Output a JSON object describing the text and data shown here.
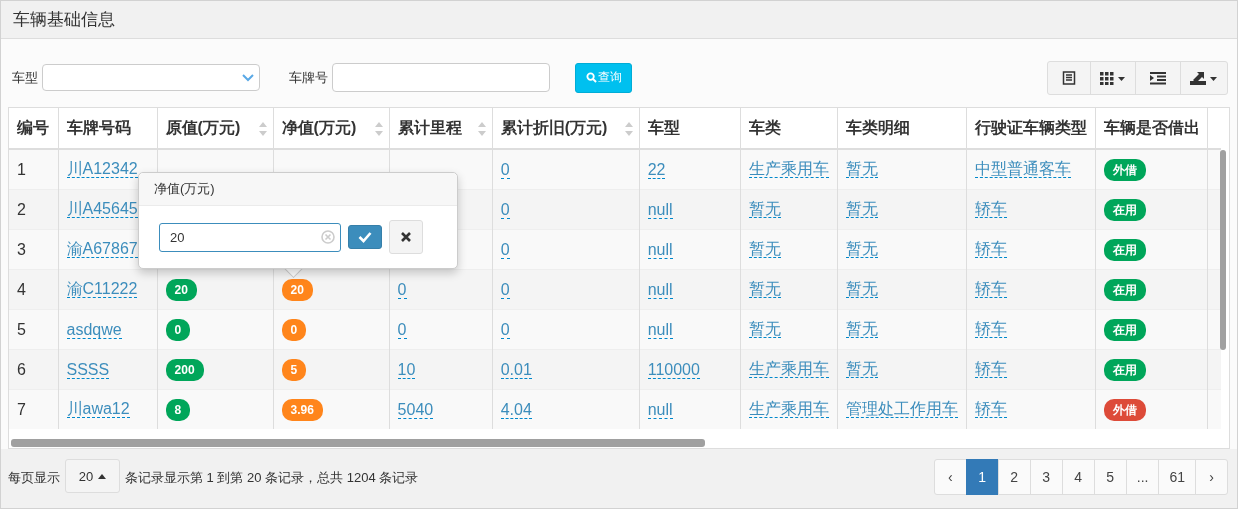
{
  "panel": {
    "title": "车辆基础信息"
  },
  "filters": {
    "vehicle_type": {
      "label": "车型"
    },
    "plate": {
      "label": "车牌号"
    },
    "search_button": "查询"
  },
  "columns": [
    {
      "label": "编号",
      "sortable": false,
      "kind": "text"
    },
    {
      "label": "车牌号码",
      "sortable": false,
      "kind": "link"
    },
    {
      "label": "原值(万元)",
      "sortable": true,
      "kind": "badge",
      "color": "#00a65a"
    },
    {
      "label": "净值(万元)",
      "sortable": true,
      "kind": "badge",
      "color": "#ff851b"
    },
    {
      "label": "累计里程",
      "sortable": true,
      "kind": "link"
    },
    {
      "label": "累计折旧(万元)",
      "sortable": true,
      "kind": "link"
    },
    {
      "label": "车型",
      "sortable": false,
      "kind": "link"
    },
    {
      "label": "车类",
      "sortable": false,
      "kind": "link"
    },
    {
      "label": "车类明细",
      "sortable": false,
      "kind": "link"
    },
    {
      "label": "行驶证车辆类型",
      "sortable": false,
      "kind": "link"
    },
    {
      "label": "车辆是否借出",
      "sortable": false,
      "kind": "status"
    }
  ],
  "rows": [
    {
      "cells": [
        "1",
        "川A12342",
        null,
        null,
        null,
        "0",
        "22",
        "生产乘用车",
        "暂无",
        "中型普通客车"
      ],
      "status": {
        "label": "外借",
        "color": "#00a65a"
      }
    },
    {
      "cells": [
        "2",
        "川A45645",
        null,
        null,
        null,
        "0",
        "null",
        "暂无",
        "暂无",
        "轿车"
      ],
      "status": {
        "label": "在用",
        "color": "#00a65a"
      }
    },
    {
      "cells": [
        "3",
        "渝A67867",
        null,
        null,
        null,
        "0",
        "null",
        "暂无",
        "暂无",
        "轿车"
      ],
      "status": {
        "label": "在用",
        "color": "#00a65a"
      }
    },
    {
      "cells": [
        "4",
        "渝C11222",
        "20",
        "20",
        "0",
        "0",
        "null",
        "暂无",
        "暂无",
        "轿车"
      ],
      "status": {
        "label": "在用",
        "color": "#00a65a"
      }
    },
    {
      "cells": [
        "5",
        "asdqwe",
        "0",
        "0",
        "0",
        "0",
        "null",
        "暂无",
        "暂无",
        "轿车"
      ],
      "status": {
        "label": "在用",
        "color": "#00a65a"
      }
    },
    {
      "cells": [
        "6",
        "SSSS",
        "200",
        "5",
        "10",
        "0.01",
        "110000",
        "生产乘用车",
        "暂无",
        "轿车"
      ],
      "status": {
        "label": "在用",
        "color": "#00a65a"
      }
    },
    {
      "cells": [
        "7",
        "川awa12",
        "8",
        "3.96",
        "5040",
        "4.04",
        "null",
        "生产乘用车",
        "管理处工作用车",
        "轿车"
      ],
      "status": {
        "label": "外借",
        "color": "#dd4b39"
      }
    }
  ],
  "editor": {
    "title": "净值(万元)",
    "value": "20"
  },
  "footer": {
    "per_page_label": "每页显示",
    "page_size": "20",
    "summary": "条记录显示第 1 到第 20 条记录，总共 1204 条记录"
  },
  "pagination": [
    {
      "label": "‹",
      "selected": false
    },
    {
      "label": "1",
      "selected": true
    },
    {
      "label": "2",
      "selected": false
    },
    {
      "label": "3",
      "selected": false
    },
    {
      "label": "4",
      "selected": false
    },
    {
      "label": "5",
      "selected": false
    },
    {
      "label": "...",
      "selected": false
    },
    {
      "label": "61",
      "selected": false
    },
    {
      "label": "›",
      "selected": false
    }
  ]
}
